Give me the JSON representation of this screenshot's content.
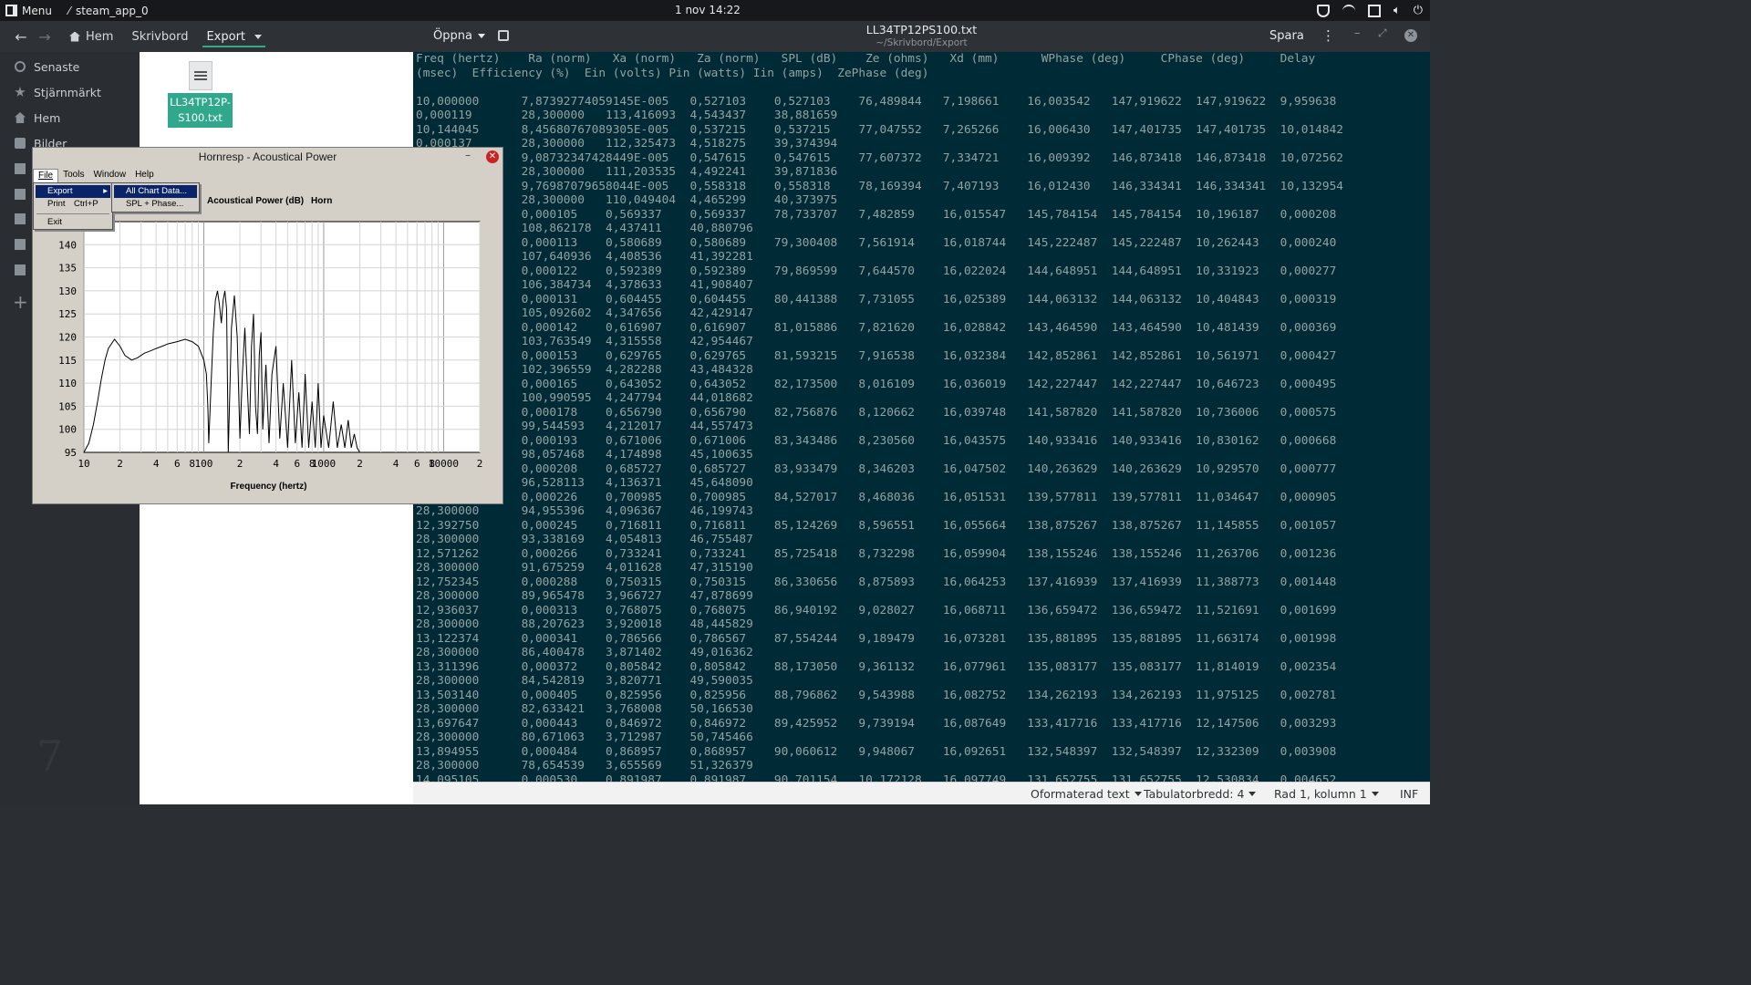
{
  "taskbar": {
    "menu_label": "Menu",
    "task_label": "steam_app_0",
    "clock": "1 nov 14:22",
    "tray_icons": [
      "shield-icon",
      "network-icon",
      "window-icon",
      "volume-icon",
      "power-icon"
    ]
  },
  "file_manager": {
    "breadcrumbs": [
      {
        "label": "Hem",
        "icon": "home-icon"
      },
      {
        "label": "Skrivbord"
      },
      {
        "label": "Export",
        "active": true
      }
    ],
    "sidebar": [
      {
        "label": "Senaste",
        "icon": "recent-icon"
      },
      {
        "label": "Stjärnmärkt",
        "icon": "star-icon"
      },
      {
        "label": "Hem",
        "icon": "home-icon"
      },
      {
        "label": "Bilder",
        "icon": "pictures-icon"
      }
    ],
    "sidebar_icons_only": [
      "documents-icon",
      "downloads-icon",
      "music-icon",
      "videos-icon",
      "trash-icon"
    ],
    "watermark": "7",
    "file": {
      "name": "LL34TP12P-S100.txt"
    }
  },
  "editor": {
    "open_label": "Öppna",
    "title": "LL34TP12PS100.txt",
    "subtitle": "~/Skrivbord/Export",
    "save_label": "Spara",
    "lines": [
      "Freq (hertz)    Ra (norm)   Xa (norm)   Za (norm)   SPL (dB)    Ze (ohms)   Xd (mm)      WPhase (deg)     CPhase (deg)     Delay",
      "(msec)  Efficiency (%)  Ein (volts) Pin (watts) Iin (amps)  ZePhase (deg)",
      "",
      "10,000000      7,87392774059145E-005   0,527103    0,527103    76,489844   7,198661    16,003542   147,919622  147,919622  9,959638",
      "0,000119       28,300000   113,416093  4,543437    38,881659",
      "10,144045      8,45680767089305E-005   0,537215    0,537215    77,047552   7,265266    16,006430   147,401735  147,401735  10,014842",
      "0,000137       28,300000   112,325473  4,518275    39,374394",
      "10,290164      9,08732347428449E-005   0,547615    0,547615    77,607372   7,334721    16,009392   146,873418  146,873418  10,072562",
      "0,000152       28,300000   111,203535  4,492241    39,871836",
      "10,438388      9,76987079658044E-005   0,558318    0,558318    78,169394   7,407193    16,012430   146,334341  146,334341  10,132954",
      "0,000173       28,300000   110,049404  4,465299    40,373975",
      "10,588745      0,000105    0,569337    0,569337    78,733707   7,482859    16,015547   145,784154  145,784154  10,196187   0,000208",
      "28,300000      108,862178  4,437411    40,880796",
      "10,741268      0,000113    0,580689    0,580689    79,300408   7,561914    16,018744   145,222487  145,222487  10,262443   0,000240",
      "28,300000      107,640936  4,408536    41,392281",
      "10,895988      0,000122    0,592389    0,592389    79,869599   7,644570    16,022024   144,648951  144,648951  10,331923   0,000277",
      "28,300000      106,384734  4,378633    41,908407",
      "11,052936      0,000131    0,604455    0,604455    80,441388   7,731055    16,025389   144,063132  144,063132  10,404843   0,000319",
      "28,300000      105,092602  4,347656    42,429147",
      "11,212145      0,000142    0,616907    0,616907    81,015886   7,821620    16,028842   143,464590  143,464590  10,481439   0,000369",
      "28,300000      103,763549  4,315558    42,954467",
      "11,373648      0,000153    0,629765    0,629765    81,593215   7,916538    16,032384   142,852861  142,852861  10,561971   0,000427",
      "28,300000      102,396559  4,282288    43,484328",
      "11,537477      0,000165    0,643052    0,643052    82,173500   8,016109    16,036019   142,227447  142,227447  10,646723   0,000495",
      "28,300000      100,990595  4,247794    44,018682",
      "11,703666      0,000178    0,656790    0,656790    82,756876   8,120662    16,039748   141,587820  141,587820  10,736006   0,000575",
      "28,300000      99,544593   4,212017    44,557473",
      "11,872249      0,000193    0,671006    0,671006    83,343486   8,230560    16,043575   140,933416  140,933416  10,830162   0,000668",
      "28,300000      98,057468   4,174898    45,100635",
      "12,043261      0,000208    0,685727    0,685727    83,933479   8,346203    16,047502   140,263629  140,263629  10,929570   0,000777",
      "28,300000      96,528113   4,136371    45,648090",
      "12,216735      0,000226    0,700985    0,700985    84,527017   8,468036    16,051531   139,577811  139,577811  11,034647   0,000905",
      "28,300000      94,955396   4,096367    46,199743",
      "12,392750      0,000245    0,716811    0,716811    85,124269   8,596551    16,055664   138,875267  138,875267  11,145855   0,001057",
      "28,300000      93,338169   4,054813    46,755487",
      "12,571262      0,000266    0,733241    0,733241    85,725418   8,732298    16,059904   138,155246  138,155246  11,263706   0,001236",
      "28,300000      91,675259   4,011628    47,315190",
      "12,752345      0,000288    0,750315    0,750315    86,330656   8,875893    16,064253   137,416939  137,416939  11,388773   0,001448",
      "28,300000      89,965478   3,966727    47,878699",
      "12,936037      0,000313    0,768075    0,768075    86,940192   9,028027    16,068711   136,659472  136,659472  11,521691   0,001699",
      "28,300000      88,207623   3,920018    48,445829",
      "13,122374      0,000341    0,786566    0,786567    87,554244   9,189479    16,073281   135,881895  135,881895  11,663174   0,001998",
      "28,300000      86,400478   3,871402    49,016362",
      "13,311396      0,000372    0,805842    0,805842    88,173050   9,361132    16,077961   135,083177  135,083177  11,814019   0,002354",
      "28,300000      84,542819   3,820771    49,590035",
      "13,503140      0,000405    0,825956    0,825956    88,796862   9,543988    16,082752   134,262193  134,262193  11,975125   0,002781",
      "28,300000      82,633421   3,768008    50,166530",
      "13,697647      0,000443    0,846972    0,846972    89,425952   9,739194    16,087649   133,417716  133,417716  12,147506   0,003293",
      "28,300000      80,671063   3,712987    50,745466",
      "13,894955      0,000484    0,868957    0,868957    90,060612   9,948067    16,092651   132,548397  132,548397  12,332309   0,003908",
      "28,300000      78,654539   3,655569    51,326379",
      "14,095105      0,000530    0,891987    0,891987    90,701154   10,172128   16,097749   131,652755  131,652755  12,530834   0,004652"
    ]
  },
  "statusbar": {
    "format": "Oformaterad text",
    "tabwidth": "Tabulatorbredd: 4",
    "position": "Rad 1, kolumn 1",
    "mode": "INF"
  },
  "hornresp": {
    "title": "Hornresp - Acoustical Power",
    "menubar": [
      "File",
      "Tools",
      "Window",
      "Help"
    ],
    "file_menu": {
      "export": "Export",
      "print": "Print",
      "print_shortcut": "Ctrl+P",
      "exit": "Exit"
    },
    "export_submenu": [
      "All Chart Data...",
      "SPL + Phase..."
    ],
    "chart_label": "Acoustical Power (dB)",
    "mode_label": "Horn"
  },
  "chart_data": {
    "type": "line",
    "title": "",
    "xlabel": "Frequency (hertz)",
    "ylabel": "",
    "x_scale": "log",
    "xlim": [
      10,
      20000
    ],
    "ylim": [
      95,
      145
    ],
    "y_ticks": [
      95,
      100,
      105,
      110,
      115,
      120,
      125,
      130,
      135,
      140
    ],
    "x_tick_labels": [
      "10",
      "2",
      "4",
      "6",
      "8",
      "100",
      "2",
      "4",
      "6",
      "8",
      "1000",
      "2",
      "4",
      "6",
      "8",
      "10000",
      "2"
    ],
    "grid": true,
    "series": [
      {
        "x": [
          10,
          11,
          12,
          13,
          14,
          15,
          16,
          18,
          20,
          22,
          25,
          28,
          32,
          36,
          40,
          45,
          50,
          60,
          70,
          80,
          90,
          100,
          105,
          108,
          110,
          115,
          120,
          125,
          130,
          135,
          140,
          145,
          150,
          155,
          160,
          170,
          180,
          190,
          200,
          210,
          220,
          230,
          240,
          250,
          260,
          270,
          280,
          290,
          300,
          310,
          330,
          350,
          370,
          400,
          430,
          460,
          500,
          540,
          580,
          620,
          660,
          700,
          750,
          800,
          850,
          900,
          950,
          1000,
          1100,
          1200,
          1300,
          1400,
          1500,
          1600,
          1700,
          1800,
          1900,
          2000
        ],
        "y": [
          95,
          97,
          101,
          106,
          111,
          115,
          117.5,
          119.5,
          118,
          116,
          115,
          115.5,
          116.5,
          117,
          117.5,
          118,
          118.5,
          119,
          119.5,
          119,
          118,
          115,
          112,
          105,
          97,
          110,
          121,
          128,
          130,
          127,
          123,
          128,
          130,
          126,
          95,
          122,
          129,
          120,
          98,
          112,
          122,
          110,
          99,
          118,
          125,
          105,
          99,
          116,
          121,
          100,
          114,
          97,
          112,
          118,
          98,
          110,
          96,
          115,
          97,
          108,
          96,
          112,
          96,
          106,
          96,
          110,
          96,
          103,
          96,
          106,
          96,
          101,
          96,
          102,
          96,
          99,
          96,
          95
        ]
      }
    ]
  }
}
